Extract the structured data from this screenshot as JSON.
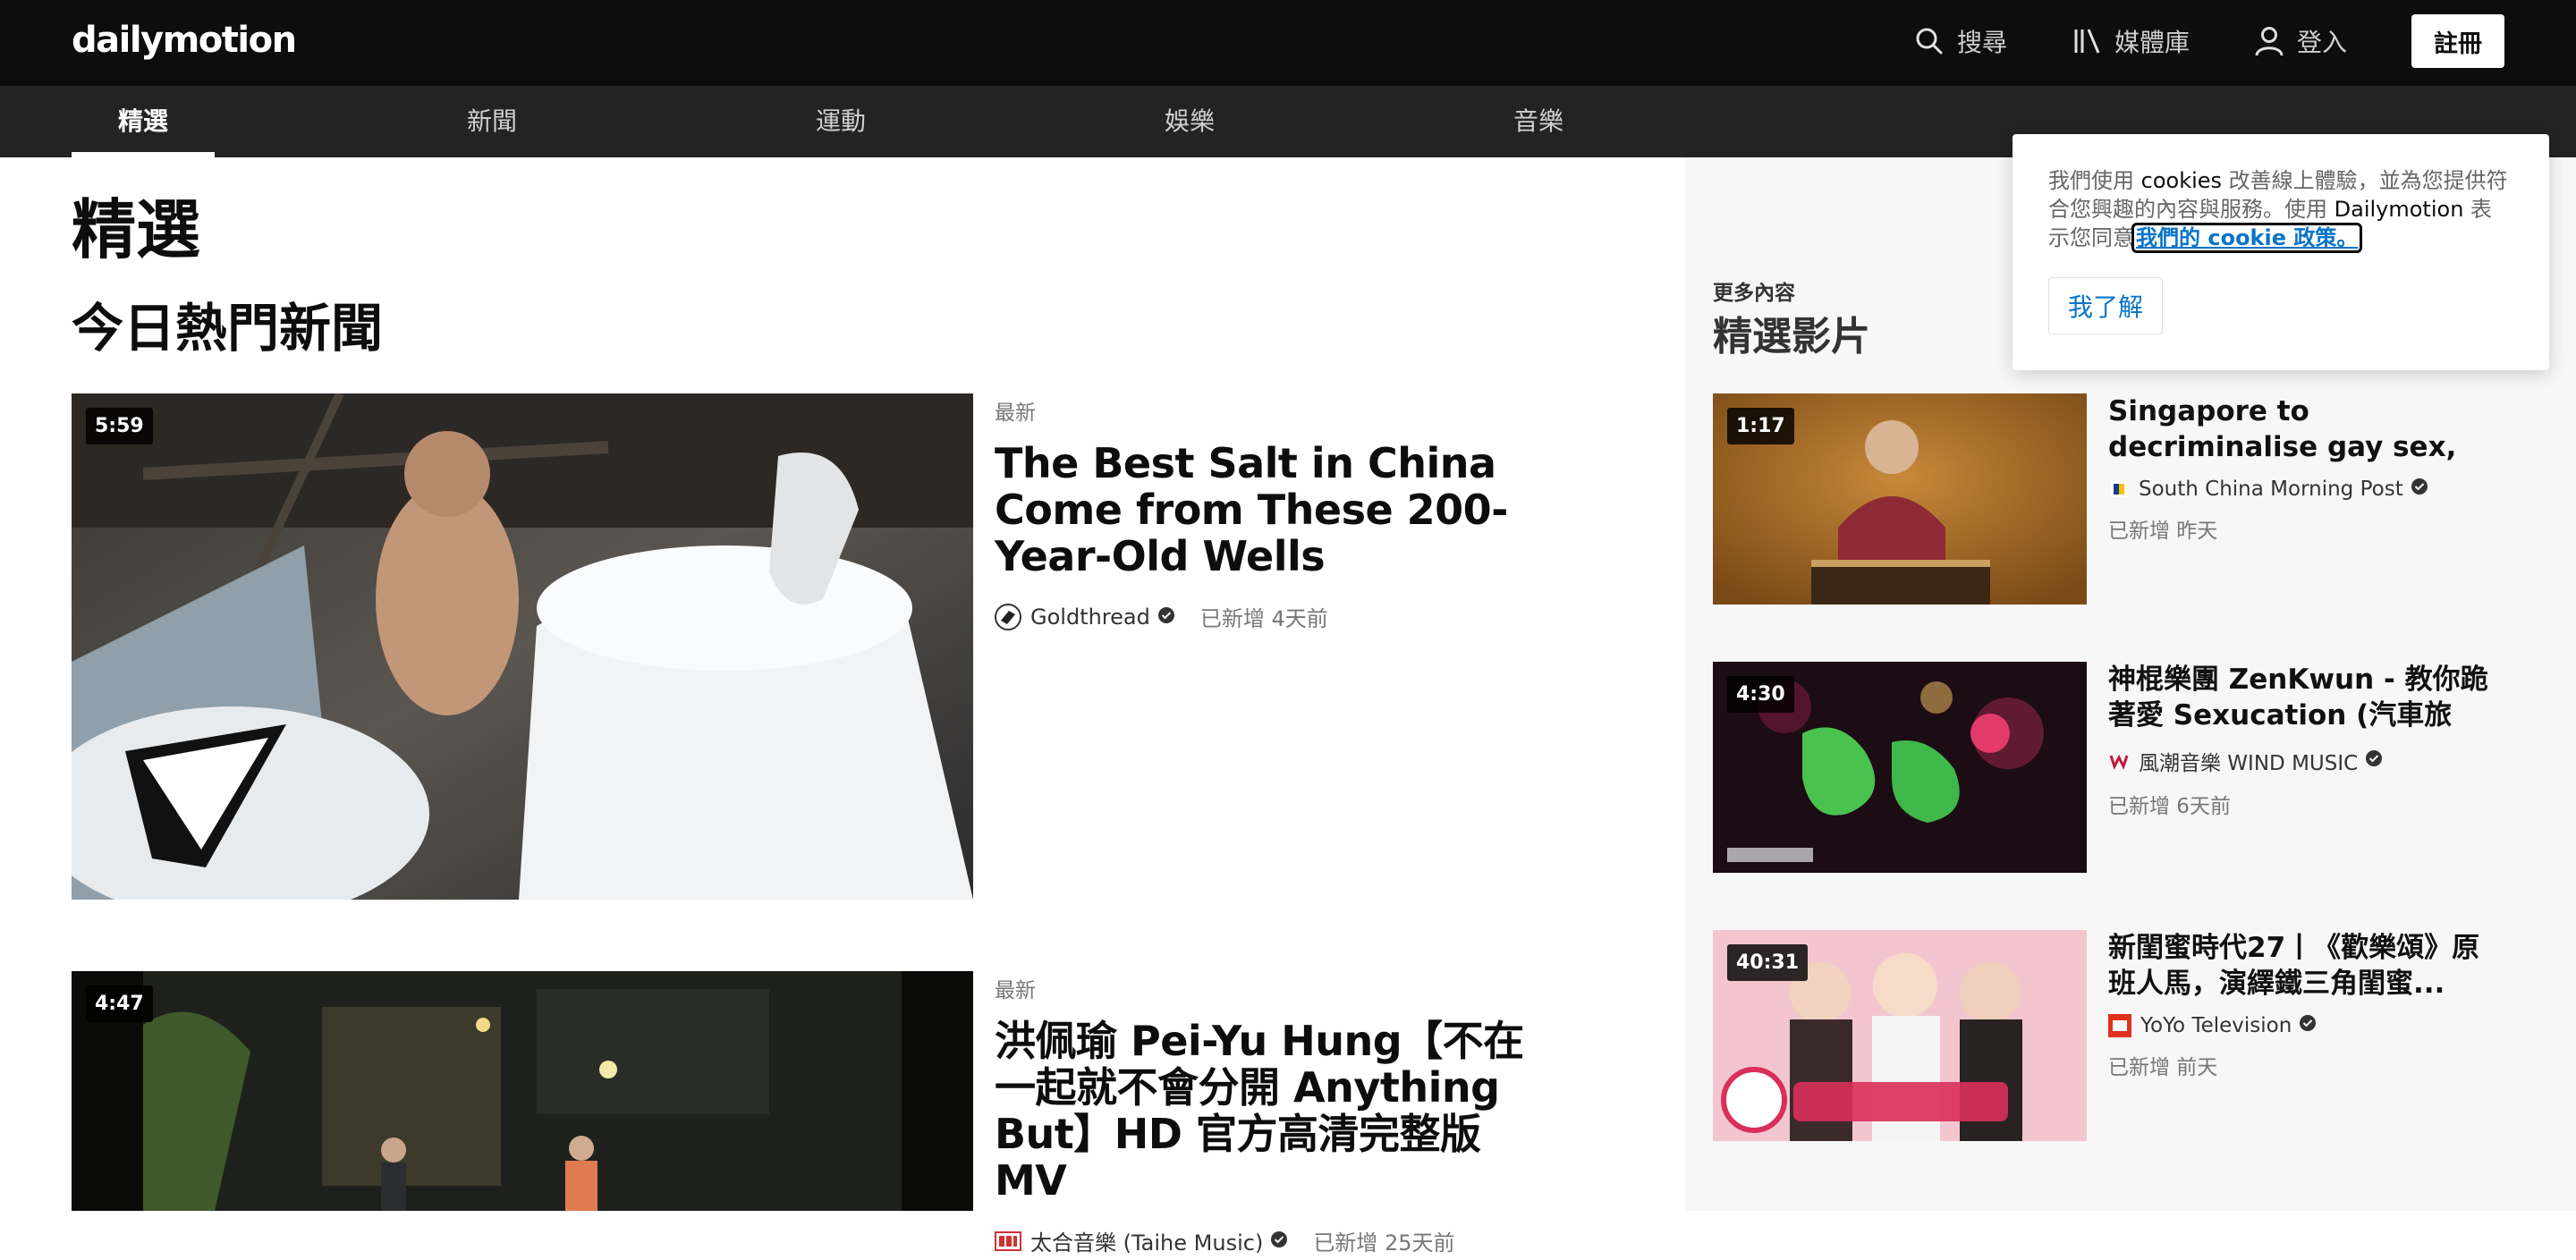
{
  "header": {
    "logo": "dailymotion",
    "search_label": "搜尋",
    "library_label": "媒體庫",
    "login_label": "登入",
    "register_label": "註冊"
  },
  "nav": {
    "tabs": [
      {
        "label": "精選",
        "active": true
      },
      {
        "label": "新聞",
        "active": false
      },
      {
        "label": "運動",
        "active": false
      },
      {
        "label": "娛樂",
        "active": false
      },
      {
        "label": "音樂",
        "active": false
      }
    ]
  },
  "main": {
    "page_title": "精選",
    "section_title": "今日熱門新聞",
    "videos": [
      {
        "duration": "5:59",
        "label": "最新",
        "title": "The Best Salt in China Come from These 200-Year-Old Wells",
        "channel": "Goldthread",
        "ago": "已新增 4天前"
      },
      {
        "duration": "4:47",
        "label": "最新",
        "title": "洪佩瑜 Pei-Yu Hung【不在一起就不會分開 Anything But】HD 官方高清完整版MV",
        "channel": "太合音樂 (Taihe Music)",
        "ago": "已新增 25天前"
      }
    ]
  },
  "sidebar": {
    "more_label": "更多內容",
    "title": "精選影片",
    "videos": [
      {
        "duration": "1:17",
        "title": "Singapore to decriminalise gay sex, but will not change...",
        "channel": "South China Morning Post",
        "ago": "已新增 昨天"
      },
      {
        "duration": "4:30",
        "title": "神棍樂團 ZenKwun - 教你跪著愛 Sexucation (汽車旅館...",
        "channel": "風潮音樂 WIND MUSIC",
        "ago": "已新增 6天前"
      },
      {
        "duration": "40:31",
        "title": "新閨蜜時代27丨《歡樂頌》原班人馬，演繹鐵三角閨蜜...",
        "channel": "YoYo Television",
        "ago": "已新增 前天"
      }
    ]
  },
  "cookie_banner": {
    "text_1": "我們使用 ",
    "text_cookies": "cookies",
    "text_2": " 改善線上體驗，並為您提供符合您興趣的內容與服務。使用 ",
    "text_brand": "Dailymotion",
    "text_3": " 表示您同意",
    "link": "我們的 cookie 政策。",
    "button": "我了解"
  },
  "colors": {
    "topbar": "#0d0d0d",
    "navbar": "#232323",
    "link_blue": "#0a74c9"
  }
}
